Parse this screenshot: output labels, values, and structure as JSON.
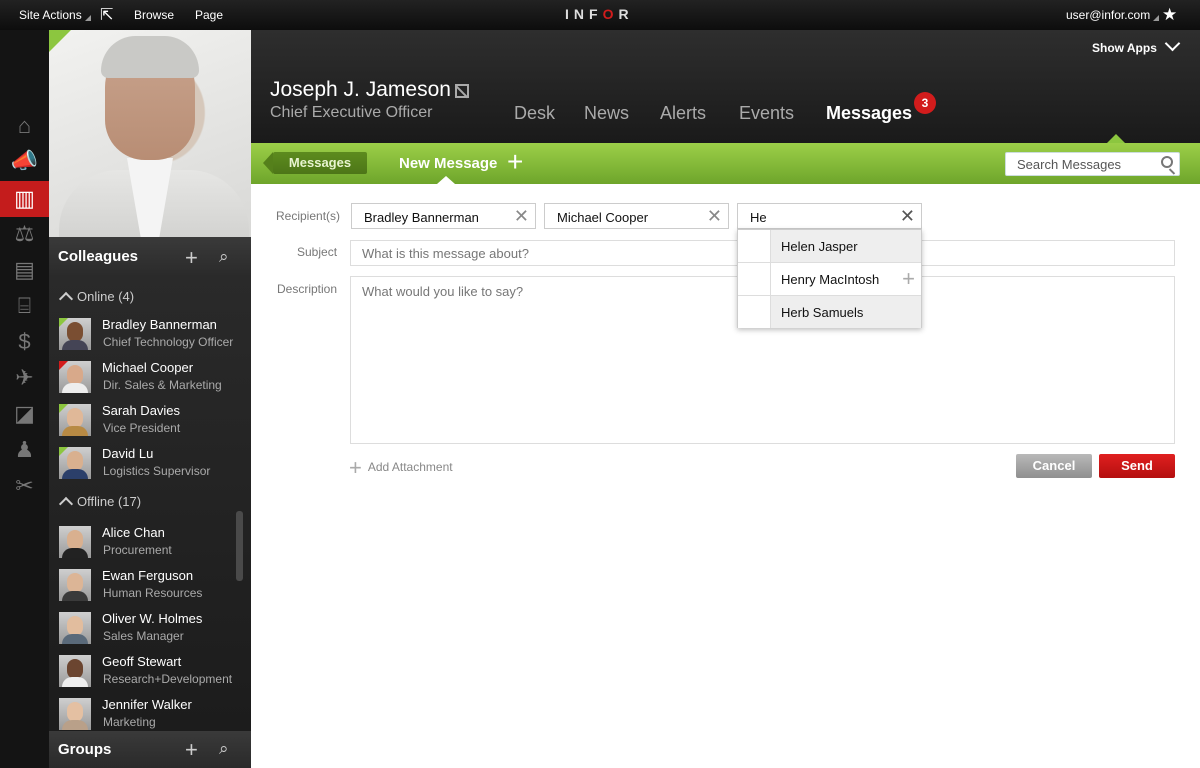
{
  "topbar": {
    "site_actions": "Site Actions",
    "browse": "Browse",
    "page": "Page",
    "logo_left": "IN",
    "logo_mid": "F",
    "logo_o": "O",
    "logo_right": "R",
    "user_email": "user@infor.com"
  },
  "profile": {
    "name": "Joseph J. Jameson",
    "title": "Chief Executive Officer"
  },
  "nav": {
    "tabs": [
      "Desk",
      "News",
      "Alerts",
      "Events",
      "Messages"
    ],
    "active": "Messages",
    "messages_badge": "3",
    "show_apps": "Show Apps"
  },
  "subnav": {
    "messages_button": "Messages",
    "new_message": "New Message",
    "search_placeholder": "Search Messages"
  },
  "sidebar": {
    "colleagues_title": "Colleagues",
    "online_label": "Online (4)",
    "offline_label": "Offline (17)",
    "groups_title": "Groups",
    "online": [
      {
        "name": "Bradley Bannerman",
        "title": "Chief Technology Officer",
        "status": "online"
      },
      {
        "name": "Michael Cooper",
        "title": "Dir. Sales & Marketing",
        "status": "busy"
      },
      {
        "name": "Sarah Davies",
        "title": "Vice President",
        "status": "online"
      },
      {
        "name": "David Lu",
        "title": "Logistics Supervisor",
        "status": "online"
      }
    ],
    "offline": [
      {
        "name": "Alice Chan",
        "title": "Procurement"
      },
      {
        "name": "Ewan Ferguson",
        "title": "Human Resources"
      },
      {
        "name": "Oliver W. Holmes",
        "title": "Sales Manager"
      },
      {
        "name": "Geoff Stewart",
        "title": "Research+Development"
      },
      {
        "name": "Jennifer Walker",
        "title": "Marketing"
      }
    ]
  },
  "form": {
    "recipients_label": "Recipient(s)",
    "subject_label": "Subject",
    "description_label": "Description",
    "recipients": [
      "Bradley Bannerman",
      "Michael Cooper"
    ],
    "recipient_input": "He",
    "subject_placeholder": "What is this message about?",
    "description_placeholder": "What would you like to say?",
    "add_attachment": "Add Attachment",
    "cancel": "Cancel",
    "send": "Send"
  },
  "autocomplete": [
    "Helen Jasper",
    "Henry MacIntosh",
    "Herb Samuels"
  ],
  "colors": {
    "accent_red": "#d21c1c",
    "accent_green": "#8cc63f",
    "dark_bg": "#1a1a1a"
  },
  "icons": [
    "home-icon",
    "megaphone-icon",
    "building-icon",
    "scales-icon",
    "clipboard-icon",
    "bank-icon",
    "dollar-icon",
    "airplane-icon",
    "chart-icon",
    "people-icon",
    "tools-icon"
  ]
}
